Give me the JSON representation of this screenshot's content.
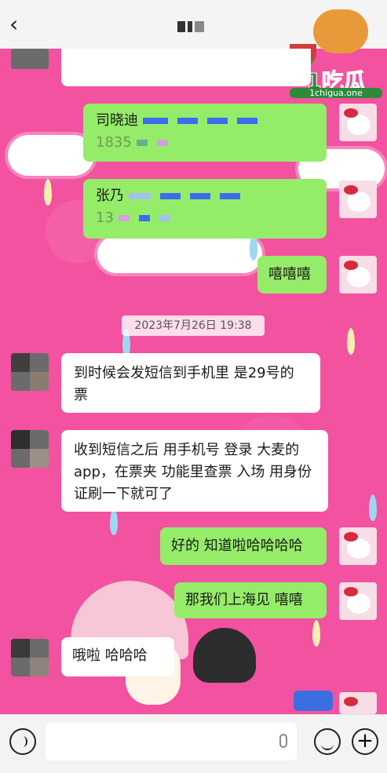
{
  "header": {
    "back_icon": "chevron-left-icon",
    "logo_text": "1吃瓜",
    "logo_domain": "1chigua.one"
  },
  "messages": [
    {
      "side": "right",
      "text": "司晓迪"
    },
    {
      "side": "right",
      "text": "张乃"
    },
    {
      "side": "right",
      "text": "嘻嘻嘻"
    },
    {
      "side": "left",
      "text": "到时候会发短信到手机里  是29号的票"
    },
    {
      "side": "left",
      "text": "收到短信之后 用手机号 登录 大麦的app，在票夹 功能里查票 入场 用身份证刷一下就可了"
    },
    {
      "side": "right",
      "text": "好的 知道啦哈哈哈哈"
    },
    {
      "side": "right",
      "text": "那我们上海见 嘻嘻"
    },
    {
      "side": "left",
      "text": "哦啦  哈哈哈"
    }
  ],
  "timestamp": "2023年7月26日 19:38",
  "partial": {
    "m1_line2": "1835",
    "m2_line2": "13"
  },
  "bottom_bar": {
    "voice_icon": "voice-icon",
    "mic_icon": "microphone-icon",
    "emoji_icon": "emoji-icon",
    "plus_icon": "plus-icon"
  }
}
